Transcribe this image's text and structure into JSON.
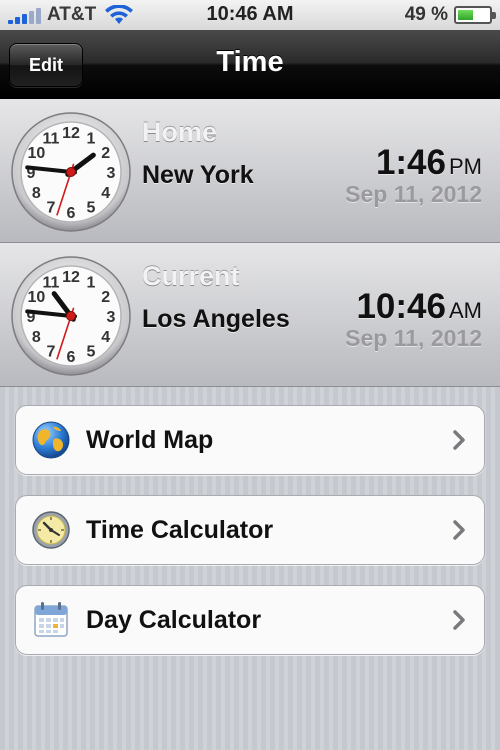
{
  "status_bar": {
    "carrier": "AT&T",
    "time": "10:46 AM",
    "battery_percent": "49 %",
    "battery_level": 0.49,
    "signal_icon": "signal-bars-icon",
    "wifi_icon": "wifi-icon"
  },
  "nav": {
    "edit_label": "Edit",
    "title": "Time"
  },
  "clocks": [
    {
      "caption": "Home",
      "city": "New York",
      "time": "1:46",
      "ampm": "PM",
      "date": "Sep 11, 2012",
      "hour": 1,
      "minute": 46,
      "second": 33
    },
    {
      "caption": "Current",
      "city": "Los Angeles",
      "time": "10:46",
      "ampm": "AM",
      "date": "Sep 11, 2012",
      "hour": 10,
      "minute": 46,
      "second": 33
    }
  ],
  "clock_numbers": [
    "12",
    "1",
    "2",
    "3",
    "4",
    "5",
    "6",
    "7",
    "8",
    "9",
    "10",
    "11"
  ],
  "menu": [
    {
      "label": "World Map",
      "icon": "globe-icon"
    },
    {
      "label": "Time Calculator",
      "icon": "compass-clock-icon"
    },
    {
      "label": "Day Calculator",
      "icon": "calendar-icon"
    }
  ],
  "colors": {
    "second_hand": "#d01a1a",
    "accent_blue": "#1d62d8"
  }
}
